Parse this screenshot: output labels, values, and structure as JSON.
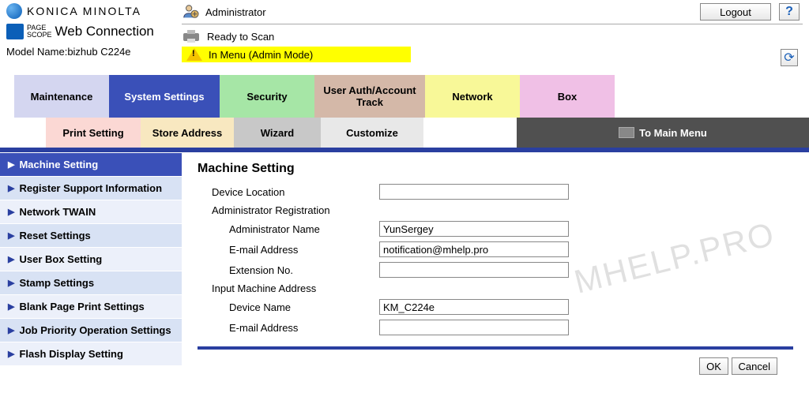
{
  "brand": "KONICA MINOLTA",
  "subtitle_small1": "PAGE",
  "subtitle_small2": "SCOPE",
  "subtitle_main": "Web Connection",
  "model_label": "Model Name:",
  "model_value": "bizhub C224e",
  "user_role": "Administrator",
  "logout": "Logout",
  "help": "?",
  "status_ready": "Ready to Scan",
  "status_menu": "In Menu (Admin Mode)",
  "refresh": "⟳",
  "tabs1": {
    "maintenance": "Maintenance",
    "system": "System Settings",
    "security": "Security",
    "user": "User Auth/Account Track",
    "network": "Network",
    "box": "Box"
  },
  "tabs2": {
    "print": "Print Setting",
    "store": "Store Address",
    "wizard": "Wizard",
    "customize": "Customize",
    "main": "To Main Menu"
  },
  "sidebar": [
    "Machine Setting",
    "Register Support Information",
    "Network TWAIN",
    "Reset Settings",
    "User Box Setting",
    "Stamp Settings",
    "Blank Page Print Settings",
    "Job Priority Operation Settings",
    "Flash Display Setting"
  ],
  "page_title": "Machine Setting",
  "fields": {
    "device_location": "Device Location",
    "admin_reg": "Administrator Registration",
    "admin_name": "Administrator Name",
    "email": "E-mail Address",
    "ext": "Extension No.",
    "input_addr": "Input Machine Address",
    "device_name": "Device Name"
  },
  "values": {
    "device_location": "",
    "admin_name": "YunSergey",
    "admin_email": "notification@mhelp.pro",
    "ext": "",
    "device_name": "KM_C224e",
    "device_email": ""
  },
  "buttons": {
    "ok": "OK",
    "cancel": "Cancel"
  },
  "watermark": "MHELP.PRO"
}
